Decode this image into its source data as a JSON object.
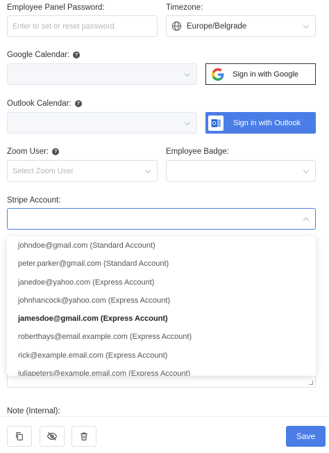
{
  "password": {
    "label": "Employee Panel Password:",
    "placeholder": "Enter to set or reset password"
  },
  "timezone": {
    "label": "Timezone:",
    "value": "Europe/Belgrade",
    "icon": "globe-icon"
  },
  "google": {
    "label": "Google Calendar:",
    "button_label": "Sign in with Google",
    "icon": "google-icon"
  },
  "outlook": {
    "label": "Outlook Calendar:",
    "button_label": "Sign in with Outlook",
    "icon": "outlook-icon",
    "color": "#4a7de6"
  },
  "zoom": {
    "label": "Zoom User:",
    "placeholder": "Select Zoom User"
  },
  "badge": {
    "label": "Employee Badge:"
  },
  "stripe": {
    "label": "Stripe Account:",
    "options": [
      "johndoe@gmail.com (Standard Account)",
      "peter.parker@gmail.com (Standard Account)",
      "janedoe@yahoo.com (Express Account)",
      "johnhancock@yahoo.com (Express Account)",
      "jamesdoe@gmail.com (Express Account)",
      "roberthays@email.example.com (Express Account)",
      "rick@example.email.com (Express Account)",
      "juliapeters@example.email.com (Express Account)"
    ],
    "selected_index": 4
  },
  "note": {
    "label": "Note (Internal):"
  },
  "footer": {
    "save_label": "Save"
  },
  "colors": {
    "accent": "#4a7de6",
    "border": "#dcdfe6"
  }
}
